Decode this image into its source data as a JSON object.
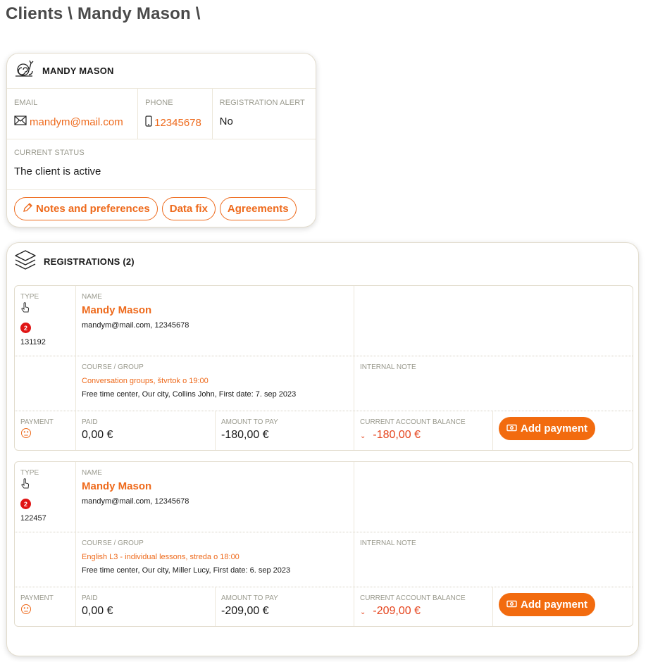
{
  "breadcrumb": "Clients \\ Mandy Mason \\",
  "client": {
    "name": "MANDY MASON",
    "email_label": "EMAIL",
    "email": "mandym@mail.com",
    "phone_label": "PHONE",
    "phone": "12345678",
    "reg_alert_label": "REGISTRATION ALERT",
    "reg_alert": "No",
    "status_label": "CURRENT STATUS",
    "status": "The client is active",
    "buttons": {
      "notes": "Notes and preferences",
      "data_fix": "Data fix",
      "agreements": "Agreements"
    }
  },
  "registrations": {
    "title": "REGISTRATIONS (2)",
    "labels": {
      "type": "TYPE",
      "name": "NAME",
      "course": "COURSE / GROUP",
      "internal_note": "INTERNAL NOTE",
      "payment": "PAYMENT",
      "paid": "PAID",
      "amount_to_pay": "AMOUNT TO PAY",
      "balance": "CURRENT ACCOUNT BALANCE",
      "add_payment": "Add payment"
    },
    "items": [
      {
        "badge": "2",
        "id": "131192",
        "name": "Mandy Mason",
        "contact": "mandym@mail.com, 12345678",
        "course": "Conversation groups, štvrtok o 19:00",
        "course_details": "Free time center, Our city, Collins John, First date: 7. sep 2023",
        "paid": "0,00 €",
        "amount_to_pay": "-180,00 €",
        "balance": "-180,00 €"
      },
      {
        "badge": "2",
        "id": "122457",
        "name": "Mandy Mason",
        "contact": "mandym@mail.com, 12345678",
        "course": "English L3 - individual lessons, streda o 18:00",
        "course_details": "Free time center, Our city, Miller Lucy, First date: 6. sep 2023",
        "paid": "0,00 €",
        "amount_to_pay": "-209,00 €",
        "balance": "-209,00 €"
      }
    ]
  },
  "colors": {
    "accent": "#ee6a1c",
    "negative": "#e5431c",
    "badge": "#e01515"
  }
}
